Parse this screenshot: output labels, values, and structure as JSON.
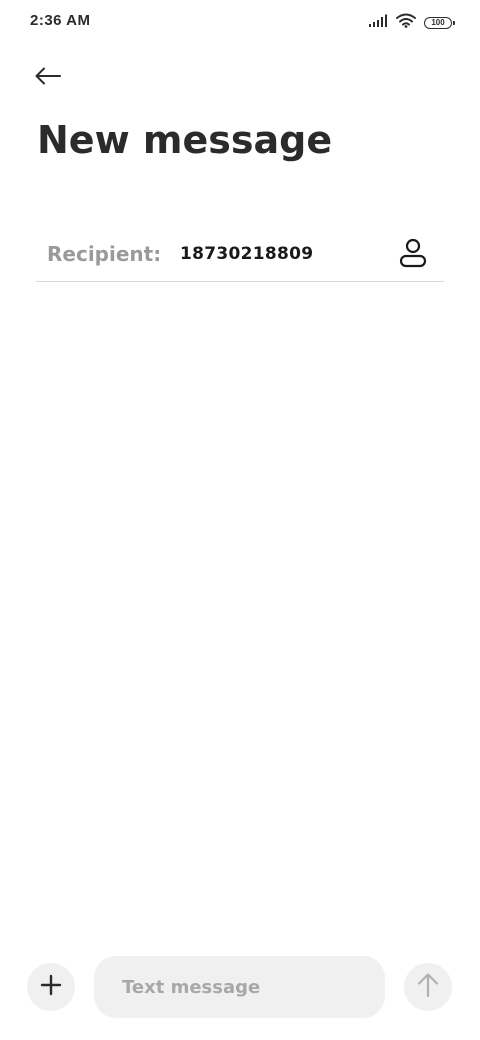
{
  "status_bar": {
    "time": "2:36 AM",
    "battery": "100",
    "icons": [
      "signal-icon",
      "wifi-icon",
      "battery-icon"
    ]
  },
  "header": {
    "back_icon": "arrow-left-icon",
    "title": "New message"
  },
  "recipient": {
    "label": "Recipient:",
    "value": "18730218809",
    "contact_icon": "person-icon"
  },
  "composer": {
    "attach_icon": "plus-icon",
    "placeholder": "Text message",
    "value": "",
    "send_icon": "arrow-up-icon"
  },
  "colors": {
    "text_primary": "#2b2b2b",
    "label_gray": "#9a9a9a",
    "input_bg": "#f0f0f0",
    "divider": "#d8d8d8",
    "send_disabled": "#b0b0b0"
  }
}
